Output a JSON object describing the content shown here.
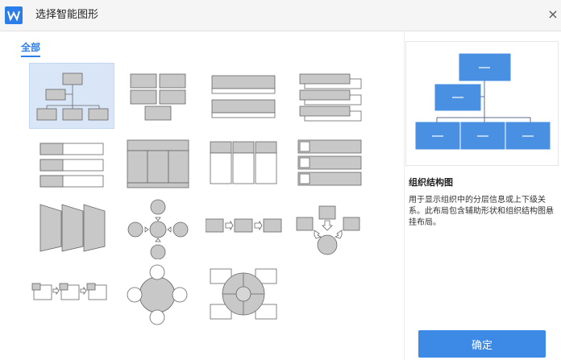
{
  "window": {
    "title": "选择智能图形",
    "close_glyph": "×",
    "app_icon": "wps-logo-icon",
    "accent": "#2b7de9"
  },
  "tabs": [
    {
      "label": "全部",
      "selected": true
    }
  ],
  "gallery": {
    "items": [
      {
        "name": "org-chart-layout",
        "selected": true
      },
      {
        "name": "block-grid-layout"
      },
      {
        "name": "stacked-bars-layout"
      },
      {
        "name": "offset-list-layout"
      },
      {
        "name": "vertical-bullet-list-layout"
      },
      {
        "name": "column-table-layout"
      },
      {
        "name": "column-bullets-layout"
      },
      {
        "name": "picture-list-layout"
      },
      {
        "name": "funnel-steps-layout"
      },
      {
        "name": "radial-arrows-layout"
      },
      {
        "name": "horizontal-process-layout"
      },
      {
        "name": "converging-arrows-layout"
      },
      {
        "name": "picture-process-layout"
      },
      {
        "name": "circle-radial-layout"
      },
      {
        "name": "quadrant-circle-layout"
      }
    ]
  },
  "detail": {
    "name": "组织结构图",
    "description": "用于显示组织中的分层信息或上下级关系。此布局包含辅助形状和组织结构图悬挂布局。",
    "shape_color": "#4a90e2"
  },
  "confirm_label": "确定"
}
